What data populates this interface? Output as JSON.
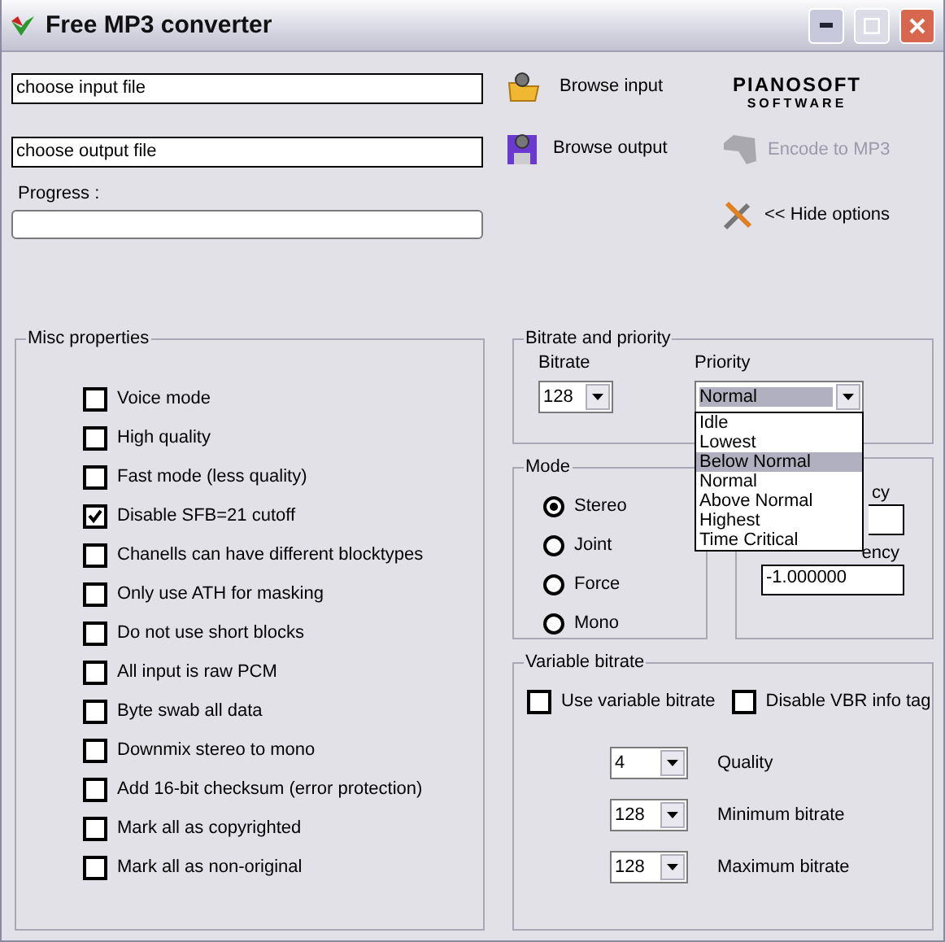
{
  "window": {
    "title": "Free MP3 converter"
  },
  "input_file": {
    "value": "choose input file"
  },
  "output_file": {
    "value": "choose output file"
  },
  "browse_input": {
    "label": "Browse input"
  },
  "browse_output": {
    "label": "Browse output"
  },
  "logo": {
    "line1": "PIANOSOFT",
    "line2": "SOFTWARE"
  },
  "encode": {
    "label": "Encode to MP3",
    "disabled": true
  },
  "hide_options": {
    "label": "<< Hide options"
  },
  "progress": {
    "label": "Progress :",
    "level": 0
  },
  "misc": {
    "title": "Misc properties",
    "options": [
      {
        "label": "Voice mode",
        "checked": false
      },
      {
        "label": "High quality",
        "checked": false
      },
      {
        "label": "Fast mode (less quality)",
        "checked": false
      },
      {
        "label": "Disable SFB=21 cutoff",
        "checked": true
      },
      {
        "label": "Chanells can have different blocktypes",
        "checked": false
      },
      {
        "label": "Only use ATH for masking",
        "checked": false
      },
      {
        "label": "Do not use short blocks",
        "checked": false
      },
      {
        "label": "All input is raw PCM",
        "checked": false
      },
      {
        "label": "Byte swab all data",
        "checked": false
      },
      {
        "label": "Downmix stereo to mono",
        "checked": false
      },
      {
        "label": "Add 16-bit checksum (error protection)",
        "checked": false
      },
      {
        "label": "Mark all as copyrighted",
        "checked": false
      },
      {
        "label": "Mark all as non-original",
        "checked": false
      }
    ]
  },
  "bitrate_priority": {
    "title": "Bitrate and priority",
    "bitrate": {
      "label": "Bitrate",
      "value": "128"
    },
    "priority": {
      "label": "Priority",
      "value": "Normal",
      "expanded": true,
      "options": [
        {
          "label": "Idle",
          "highlighted": false
        },
        {
          "label": "Lowest",
          "highlighted": false
        },
        {
          "label": "Below Normal",
          "highlighted": true
        },
        {
          "label": "Normal",
          "highlighted": false
        },
        {
          "label": "Above Normal",
          "highlighted": false
        },
        {
          "label": "Highest",
          "highlighted": false
        },
        {
          "label": "Time Critical",
          "highlighted": false
        }
      ]
    }
  },
  "mode": {
    "title": "Mode",
    "options": [
      {
        "label": "Stereo",
        "selected": true
      },
      {
        "label": "Joint",
        "selected": false
      },
      {
        "label": "Force",
        "selected": false
      },
      {
        "label": "Mono",
        "selected": false
      }
    ]
  },
  "frequency": {
    "input_label": "cy",
    "output_label": "ency",
    "output_value": "-1.000000"
  },
  "vbr": {
    "title": "Variable bitrate",
    "use_vbr": {
      "label": "Use variable bitrate",
      "checked": false
    },
    "disable_tag": {
      "label": "Disable VBR info tag",
      "checked": false
    },
    "settings": [
      {
        "value": "4",
        "label": "Quality"
      },
      {
        "value": "128",
        "label": "Minimum bitrate"
      },
      {
        "value": "128",
        "label": "Maximum bitrate"
      }
    ]
  }
}
